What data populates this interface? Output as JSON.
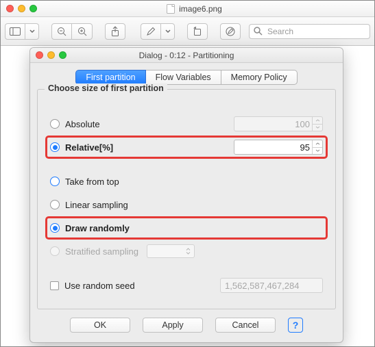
{
  "window": {
    "title": "image6.png"
  },
  "toolbar": {
    "search_placeholder": "Search"
  },
  "dialog": {
    "title": "Dialog - 0:12 - Partitioning",
    "tabs": [
      "First partition",
      "Flow Variables",
      "Memory Policy"
    ],
    "active_tab": 0,
    "fieldset_title": "Choose size of first partition",
    "size_mode": {
      "options": {
        "absolute": "Absolute",
        "relative": "Relative[%]"
      },
      "selected": "relative",
      "absolute_value": "100",
      "relative_value": "95"
    },
    "sampling": {
      "options": {
        "take_top": "Take from top",
        "linear": "Linear sampling",
        "random": "Draw randomly",
        "stratified": "Stratified sampling"
      },
      "selected": "random",
      "stratified_enabled": false
    },
    "seed": {
      "label": "Use random seed",
      "checked": false,
      "value": "1,562,587,467,284"
    },
    "buttons": {
      "ok": "OK",
      "apply": "Apply",
      "cancel": "Cancel",
      "help": "?"
    }
  }
}
